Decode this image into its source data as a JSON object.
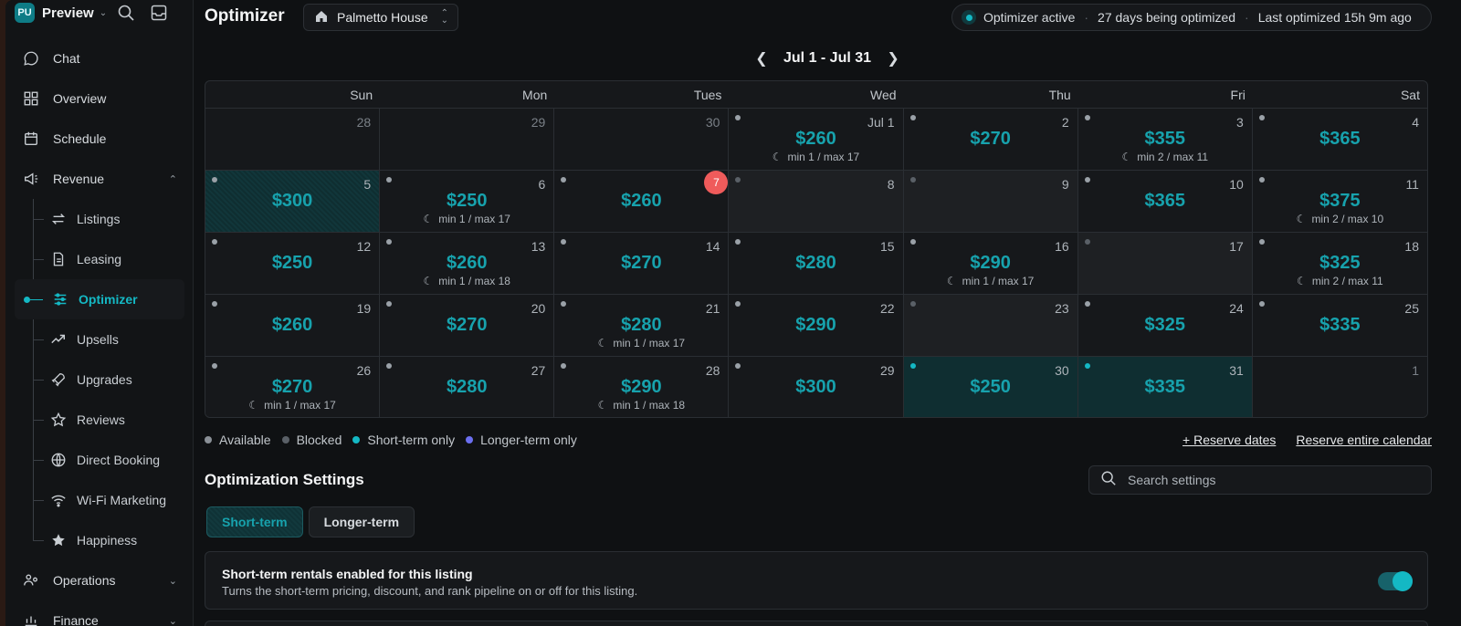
{
  "workspace": {
    "initials": "PU",
    "name": "Preview"
  },
  "nav": [
    {
      "label": "Chat",
      "icon": "chat-icon"
    },
    {
      "label": "Overview",
      "icon": "grid-icon"
    },
    {
      "label": "Schedule",
      "icon": "calendar-icon"
    },
    {
      "label": "Revenue",
      "icon": "megaphone-icon"
    }
  ],
  "revenue_sub": [
    {
      "label": "Listings",
      "icon": "swap-icon"
    },
    {
      "label": "Leasing",
      "icon": "document-icon"
    },
    {
      "label": "Optimizer",
      "icon": "sliders-icon"
    },
    {
      "label": "Upsells",
      "icon": "trend-icon"
    },
    {
      "label": "Upgrades",
      "icon": "rocket-icon"
    },
    {
      "label": "Reviews",
      "icon": "star-outline-icon"
    },
    {
      "label": "Direct Booking",
      "icon": "globe-icon"
    },
    {
      "label": "Wi-Fi Marketing",
      "icon": "wifi-icon"
    },
    {
      "label": "Happiness",
      "icon": "star-filled-icon"
    }
  ],
  "nav_bottom": [
    {
      "label": "Operations",
      "icon": "people-gear-icon"
    },
    {
      "label": "Finance",
      "icon": "finance-icon"
    }
  ],
  "header": {
    "title": "Optimizer",
    "property": "Palmetto House",
    "status_active": "Optimizer active",
    "status_days": "27 days being optimized",
    "status_last": "Last optimized 15h 9m ago"
  },
  "calendar": {
    "range": "Jul 1 - Jul 31",
    "weekdays": [
      "Sun",
      "Mon",
      "Tues",
      "Wed",
      "Thu",
      "Fri",
      "Sat"
    ],
    "cells": [
      {
        "day": "28",
        "state": "empty",
        "muted": true
      },
      {
        "day": "29",
        "state": "empty",
        "muted": true
      },
      {
        "day": "30",
        "state": "empty",
        "muted": true
      },
      {
        "day": "Jul  1",
        "state": "available",
        "price": "$260",
        "stay": "min 1 / max 17"
      },
      {
        "day": "2",
        "state": "available",
        "price": "$270"
      },
      {
        "day": "3",
        "state": "available",
        "price": "$355",
        "stay": "min 2 / max 11"
      },
      {
        "day": "4",
        "state": "available",
        "price": "$365"
      },
      {
        "day": "5",
        "state": "short-hatch",
        "price": "$300"
      },
      {
        "day": "6",
        "state": "available",
        "price": "$250",
        "stay": "min 1 / max 17"
      },
      {
        "day": "7",
        "state": "available",
        "price": "$260",
        "today": true
      },
      {
        "day": "8",
        "state": "blocked"
      },
      {
        "day": "9",
        "state": "blocked"
      },
      {
        "day": "10",
        "state": "available",
        "price": "$365"
      },
      {
        "day": "11",
        "state": "available",
        "price": "$375",
        "stay": "min 2 / max 10"
      },
      {
        "day": "12",
        "state": "available",
        "price": "$250"
      },
      {
        "day": "13",
        "state": "available",
        "price": "$260",
        "stay": "min 1 / max 18"
      },
      {
        "day": "14",
        "state": "available",
        "price": "$270"
      },
      {
        "day": "15",
        "state": "available",
        "price": "$280"
      },
      {
        "day": "16",
        "state": "available",
        "price": "$290",
        "stay": "min 1 / max 17"
      },
      {
        "day": "17",
        "state": "blocked"
      },
      {
        "day": "18",
        "state": "available",
        "price": "$325",
        "stay": "min 2 / max 11"
      },
      {
        "day": "19",
        "state": "available",
        "price": "$260"
      },
      {
        "day": "20",
        "state": "available",
        "price": "$270"
      },
      {
        "day": "21",
        "state": "available",
        "price": "$280",
        "stay": "min 1 / max 17"
      },
      {
        "day": "22",
        "state": "available",
        "price": "$290"
      },
      {
        "day": "23",
        "state": "blocked"
      },
      {
        "day": "24",
        "state": "available",
        "price": "$325"
      },
      {
        "day": "25",
        "state": "available",
        "price": "$335"
      },
      {
        "day": "26",
        "state": "available",
        "price": "$270",
        "stay": "min 1 / max 17"
      },
      {
        "day": "27",
        "state": "available",
        "price": "$280"
      },
      {
        "day": "28",
        "state": "available",
        "price": "$290",
        "stay": "min 1 / max 18"
      },
      {
        "day": "29",
        "state": "available",
        "price": "$300"
      },
      {
        "day": "30",
        "state": "short",
        "price": "$250"
      },
      {
        "day": "31",
        "state": "short",
        "price": "$335"
      },
      {
        "day": "1",
        "state": "empty",
        "muted": true
      }
    ]
  },
  "legend": [
    {
      "label": "Available",
      "color": "#8a9097"
    },
    {
      "label": "Blocked",
      "color": "#5a6067"
    },
    {
      "label": "Short-term only",
      "color": "#14b8c4"
    },
    {
      "label": "Longer-term only",
      "color": "#6b6ff0"
    }
  ],
  "actions": {
    "reserve_dates": "+ Reserve dates",
    "reserve_all": "Reserve entire calendar"
  },
  "settings": {
    "title": "Optimization Settings",
    "search_placeholder": "Search settings",
    "tabs": [
      "Short-term",
      "Longer-term"
    ],
    "card_title": "Short-term rentals enabled for this listing",
    "card_desc": "Turns the short-term pricing, discount, and rank pipeline on or off for this listing.",
    "enabled": true
  },
  "colors": {
    "accent": "#14b8c4",
    "today": "#ef5b5b"
  }
}
